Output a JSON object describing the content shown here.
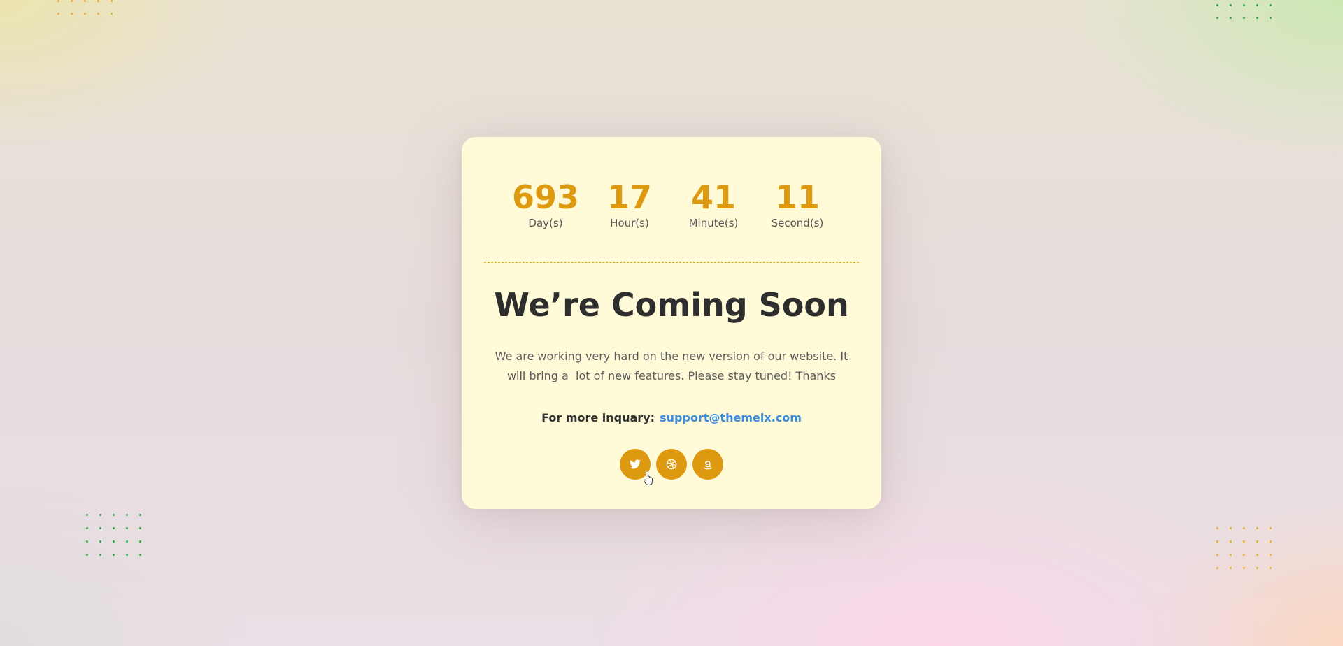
{
  "colors": {
    "accent": "#dd990f",
    "card_background": "#fffbd8",
    "heading": "#2e2e2e",
    "link": "#3a8de0",
    "dots_yellow": "#e0b32a",
    "dots_green": "#2fa84a"
  },
  "countdown": [
    {
      "value": "693",
      "label": "Day(s)"
    },
    {
      "value": "17",
      "label": "Hour(s)"
    },
    {
      "value": "41",
      "label": "Minute(s)"
    },
    {
      "value": "11",
      "label": "Second(s)"
    }
  ],
  "heading": "We’re Coming Soon",
  "description_line1": "We are working very hard on the new version of our website. It",
  "description_line2": "will bring a  lot of new features. Please stay tuned! Thanks",
  "inquiry": {
    "label": "For more inquary:",
    "email": "support@themeix.com"
  },
  "social": [
    {
      "icon": "twitter-icon"
    },
    {
      "icon": "dribbble-icon"
    },
    {
      "icon": "amazon-icon"
    }
  ]
}
